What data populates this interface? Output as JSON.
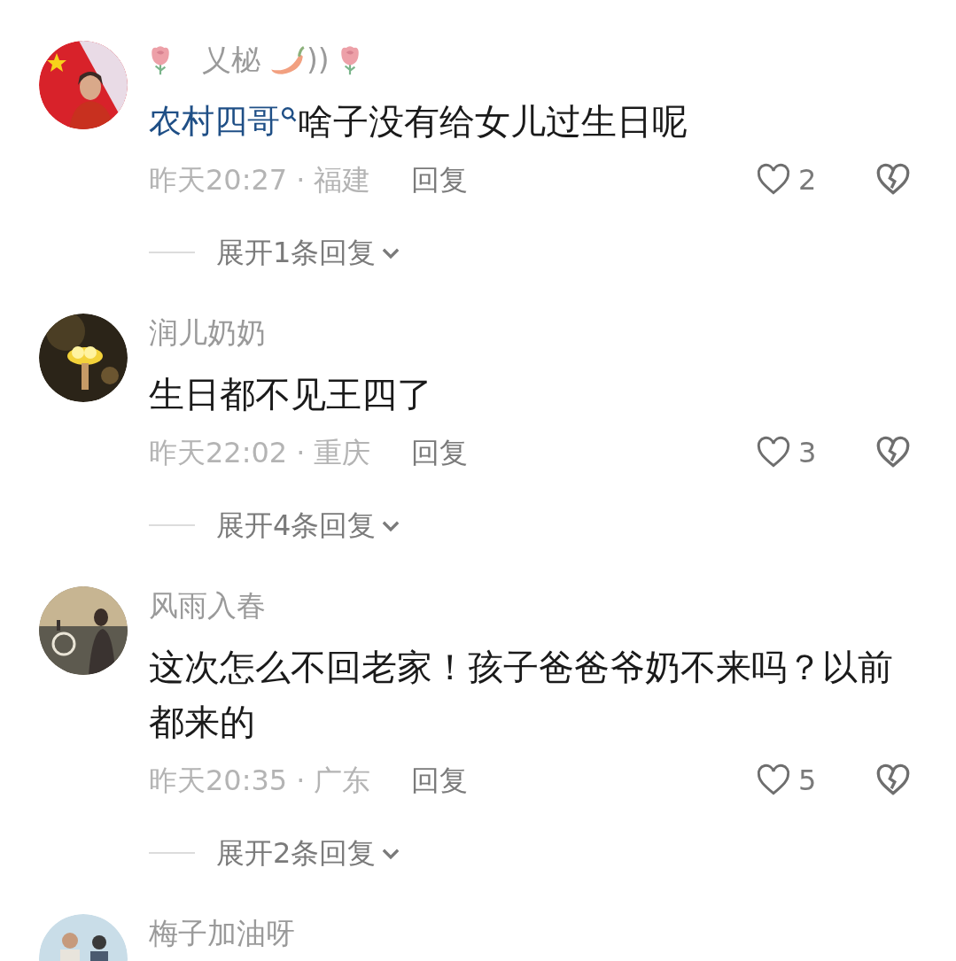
{
  "comments": [
    {
      "name": "乂柲",
      "name_suffix": "))",
      "decorated": true,
      "mention": "农村四哥",
      "text": "啥子没有给女儿过生日呢",
      "time": "昨天20:27",
      "separator": "·",
      "region": "福建",
      "reply": "回复",
      "likes": "2",
      "expand": "展开1条回复"
    },
    {
      "name": "润儿奶奶",
      "text": "生日都不见王四了",
      "time": "昨天22:02",
      "separator": "·",
      "region": "重庆",
      "reply": "回复",
      "likes": "3",
      "expand": "展开4条回复"
    },
    {
      "name": "风雨入春",
      "text": "这次怎么不回老家！孩子爸爸爷奶不来吗？以前都来的",
      "time": "昨天20:35",
      "separator": "·",
      "region": "广东",
      "reply": "回复",
      "likes": "5",
      "expand": "展开2条回复"
    },
    {
      "name": "梅子加油呀"
    }
  ]
}
